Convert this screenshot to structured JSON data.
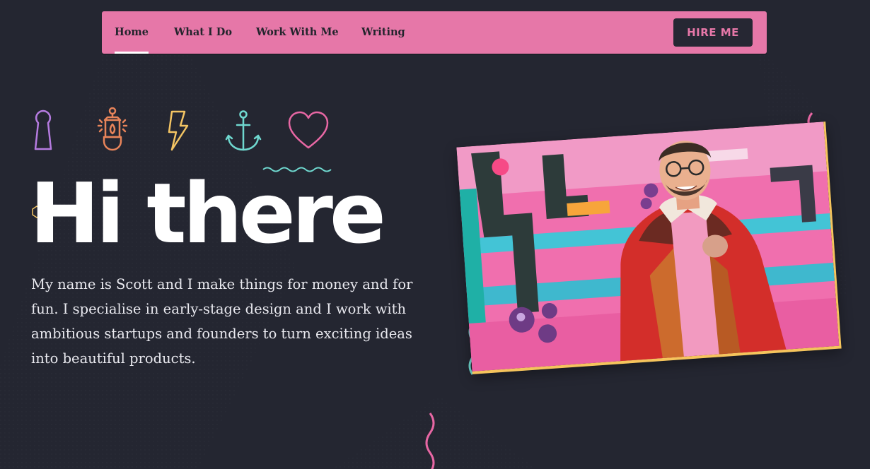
{
  "nav": {
    "links": [
      {
        "label": "Home",
        "active": true
      },
      {
        "label": "What I Do",
        "active": false
      },
      {
        "label": "Work With Me",
        "active": false
      },
      {
        "label": "Writing",
        "active": false
      }
    ],
    "cta_label": "HIRE ME"
  },
  "icons": [
    "keyhole-icon",
    "lantern-icon",
    "lightning-bolt-icon",
    "anchor-icon",
    "heart-icon"
  ],
  "hero": {
    "headline": "Hi there",
    "intro": "My name is Scott and I make things for money and for fun. I specialise in early-stage design and I work with ambitious startups and founders to turn exciting ideas into beautiful products."
  },
  "photo": {
    "description_icon": "portrait-photo"
  },
  "colors": {
    "background": "#242631",
    "nav_bg": "#e677a8",
    "button_bg": "#262733",
    "button_text": "#e677a8",
    "photo_border": "#f5c45c",
    "icon_purple": "#b57be0",
    "icon_orange": "#e8845a",
    "icon_yellow": "#f3c463",
    "icon_teal": "#6fd8cf",
    "icon_pink": "#e867a4"
  }
}
